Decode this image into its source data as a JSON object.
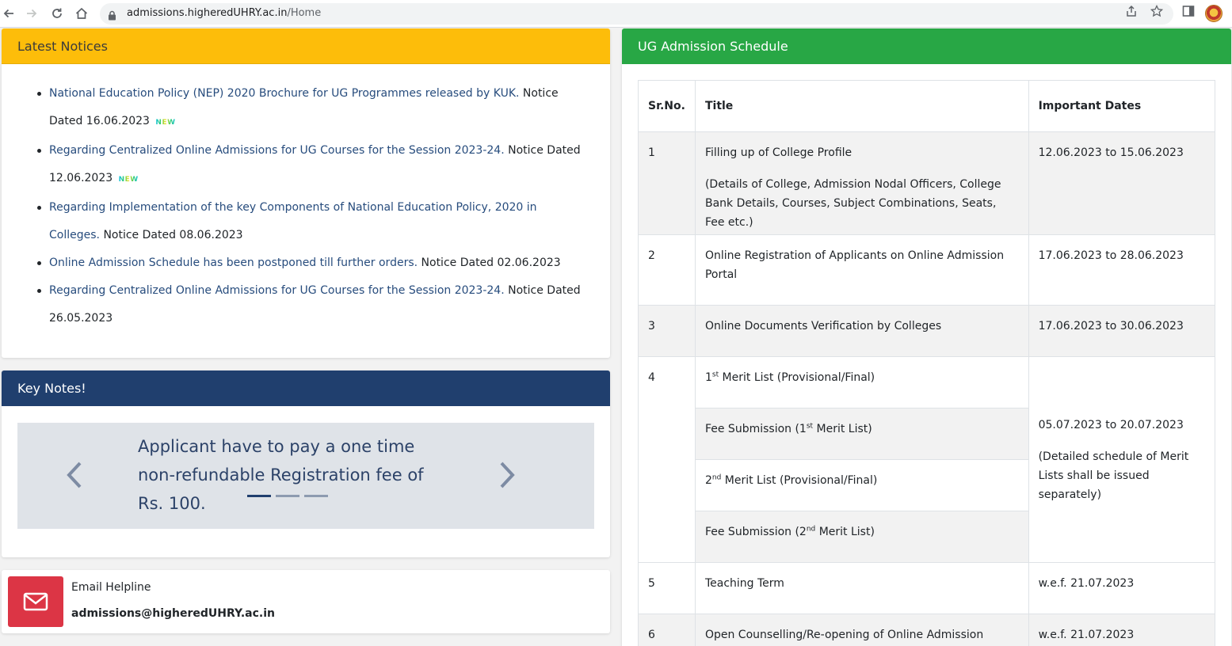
{
  "browser": {
    "url_host": "admissions.higheredUHRY.ac.in",
    "url_path": "/Home"
  },
  "notices": {
    "header": "Latest Notices",
    "new_label": "NEW",
    "items": [
      {
        "link": "National Education Policy (NEP) 2020 Brochure for UG Programmes released by KUK.",
        "date": "Notice Dated 16.06.2023",
        "is_new": true
      },
      {
        "link": "Regarding Centralized Online Admissions for UG Courses for the Session 2023-24.",
        "date": "Notice Dated 12.06.2023",
        "is_new": true
      },
      {
        "link": "Regarding Implementation of the key Components of National Education Policy, 2020 in Colleges.",
        "date": "Notice Dated 08.06.2023",
        "is_new": false
      },
      {
        "link": "Online Admission Schedule has been postponed till further orders.",
        "date": "Notice Dated 02.06.2023",
        "is_new": false
      },
      {
        "link": "Regarding Centralized Online Admissions for UG Courses for the Session 2023-24.",
        "date": "Notice Dated 26.05.2023",
        "is_new": false
      }
    ]
  },
  "keynotes": {
    "header": "Key Notes!",
    "slide_text": "Applicant have to pay a one time non-refundable Registration fee of Rs. 100."
  },
  "helpline": {
    "label": "Email Helpline",
    "email": "admissions@higheredUHRY.ac.in"
  },
  "schedule": {
    "header": "UG Admission Schedule",
    "columns": {
      "srno": "Sr.No.",
      "title": "Title",
      "dates": "Important Dates"
    },
    "rows": {
      "r1": {
        "no": "1",
        "title": "Filling up of College Profile",
        "detail": "(Details of College, Admission Nodal Officers, College Bank Details, Courses, Subject Combinations, Seats, Fee etc.)",
        "date": "12.06.2023 to 15.06.2023"
      },
      "r2": {
        "no": "2",
        "title": "Online Registration of Applicants on Online Admission Portal",
        "date": "17.06.2023 to 28.06.2023"
      },
      "r3": {
        "no": "3",
        "title": "Online Documents Verification by Colleges",
        "date": "17.06.2023 to 30.06.2023"
      },
      "r4": {
        "no": "4",
        "sub1_num": "1",
        "sub1_sup": "st",
        "sub1_rest": " Merit List (Provisional/Final)",
        "sub2_pre": "Fee Submission (1",
        "sub2_sup": "st",
        "sub2_post": " Merit List)",
        "sub3_num": "2",
        "sub3_sup": "nd",
        "sub3_rest": " Merit List (Provisional/Final)",
        "sub4_pre": "Fee Submission (2",
        "sub4_sup": "nd",
        "sub4_post": " Merit List)",
        "date": "05.07.2023 to 20.07.2023",
        "date_detail": "(Detailed schedule of Merit Lists shall be issued separately)"
      },
      "r5": {
        "no": "5",
        "title": "Teaching Term",
        "date": "w.e.f. 21.07.2023"
      },
      "r6": {
        "no": "6",
        "title": "Open Counselling/Re-opening of Online Admission Portal",
        "date": "w.e.f. 21.07.2023"
      }
    }
  }
}
